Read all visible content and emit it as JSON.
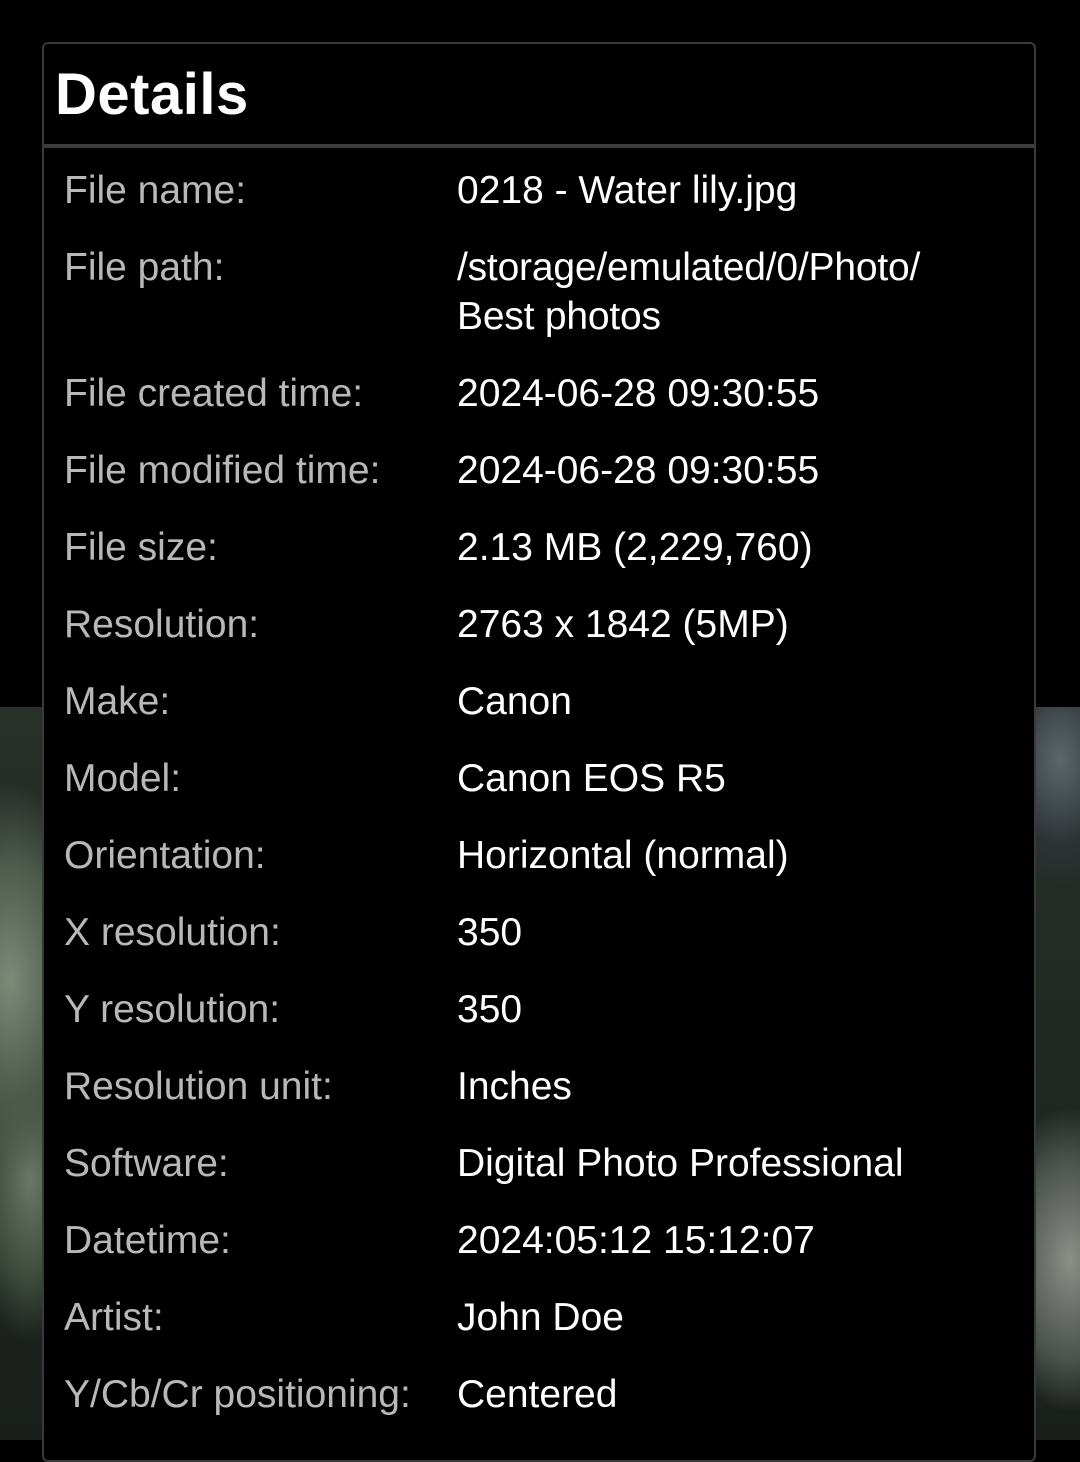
{
  "dialog": {
    "title": "Details",
    "rows": [
      {
        "label": "File name:",
        "value": "0218 - Water lily.jpg"
      },
      {
        "label": "File path:",
        "value": "/storage/emulated/0/Photo/\nBest photos"
      },
      {
        "label": "File created time:",
        "value": "2024-06-28 09:30:55"
      },
      {
        "label": "File modified time:",
        "value": "2024-06-28 09:30:55"
      },
      {
        "label": "File size:",
        "value": "2.13 MB (2,229,760)"
      },
      {
        "label": "Resolution:",
        "value": "2763 x 1842 (5MP)"
      },
      {
        "label": "Make:",
        "value": "Canon"
      },
      {
        "label": "Model:",
        "value": "Canon EOS R5"
      },
      {
        "label": "Orientation:",
        "value": "Horizontal (normal)"
      },
      {
        "label": "X resolution:",
        "value": "350"
      },
      {
        "label": "Y resolution:",
        "value": "350"
      },
      {
        "label": "Resolution unit:",
        "value": "Inches"
      },
      {
        "label": "Software:",
        "value": "Digital Photo Professional"
      },
      {
        "label": "Datetime:",
        "value": "2024:05:12 15:12:07"
      },
      {
        "label": "Artist:",
        "value": "John Doe"
      },
      {
        "label": "Y/Cb/Cr positioning:",
        "value": "Centered"
      }
    ]
  },
  "colors": {
    "background": "#000000",
    "label": "#b8b8b8",
    "value": "#ffffff",
    "divider": "#3c3c3c"
  }
}
